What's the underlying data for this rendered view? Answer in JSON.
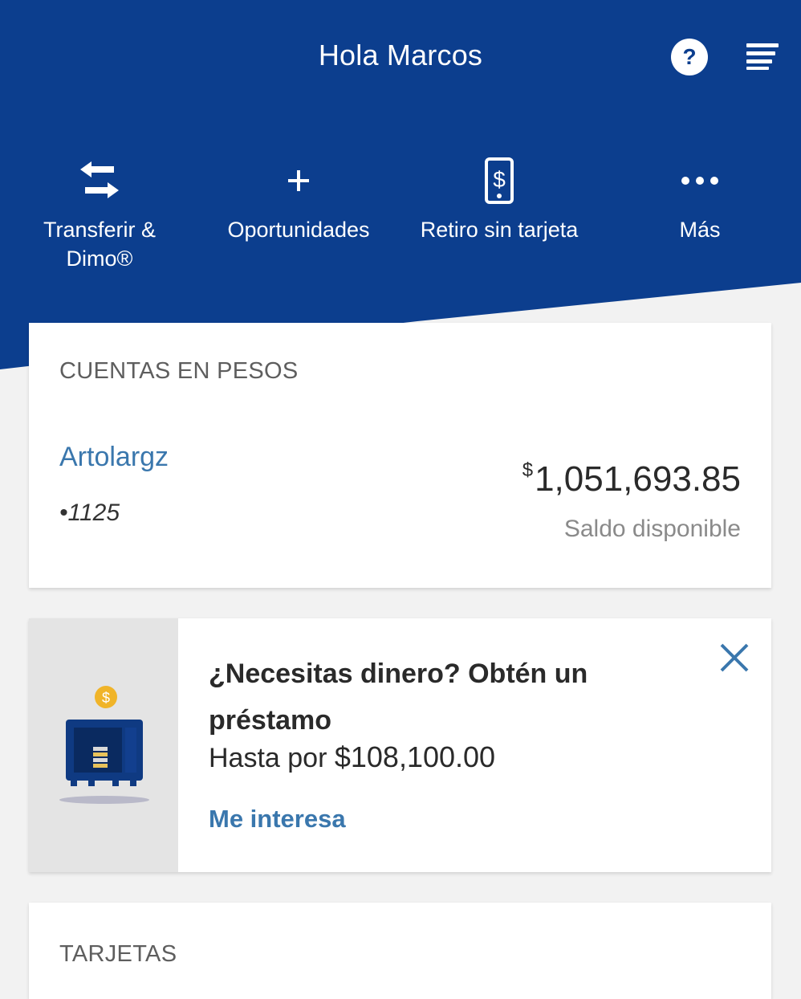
{
  "header": {
    "greeting": "Hola Marcos",
    "help_icon": "question-circle-icon",
    "help_label": "?",
    "menu_icon": "hamburger-menu-icon",
    "color": "#0c3e8e"
  },
  "quick_actions": [
    {
      "line1": "Transferir &",
      "line2": "Dimo®",
      "icon": "transfer-arrows-icon"
    },
    {
      "line1": "Oportunidades",
      "line2": "",
      "icon": "plus-icon"
    },
    {
      "line1": "Retiro sin tarjeta",
      "line2": "",
      "icon": "phone-dollar-icon"
    },
    {
      "line1": "Más",
      "line2": "",
      "icon": "more-dots-icon"
    }
  ],
  "accounts": {
    "section_title": "CUENTAS EN PESOS",
    "account": {
      "name": "Artolargz",
      "number": "•1125",
      "currency_symbol": "$",
      "balance": "1,051,693.85",
      "balance_label": "Saldo disponible"
    }
  },
  "promo": {
    "title": "¿Necesitas dinero? Obtén un préstamo",
    "amount_prefix": "Hasta por",
    "amount": "$108,100.00",
    "link": "Me interesa",
    "illustration_icon": "safe-with-coins-icon",
    "close_icon": "close-icon"
  },
  "cards_section": {
    "title": "TARJETAS"
  },
  "colors": {
    "brand_blue": "#0c3e8e",
    "link_blue": "#3a77ad"
  }
}
